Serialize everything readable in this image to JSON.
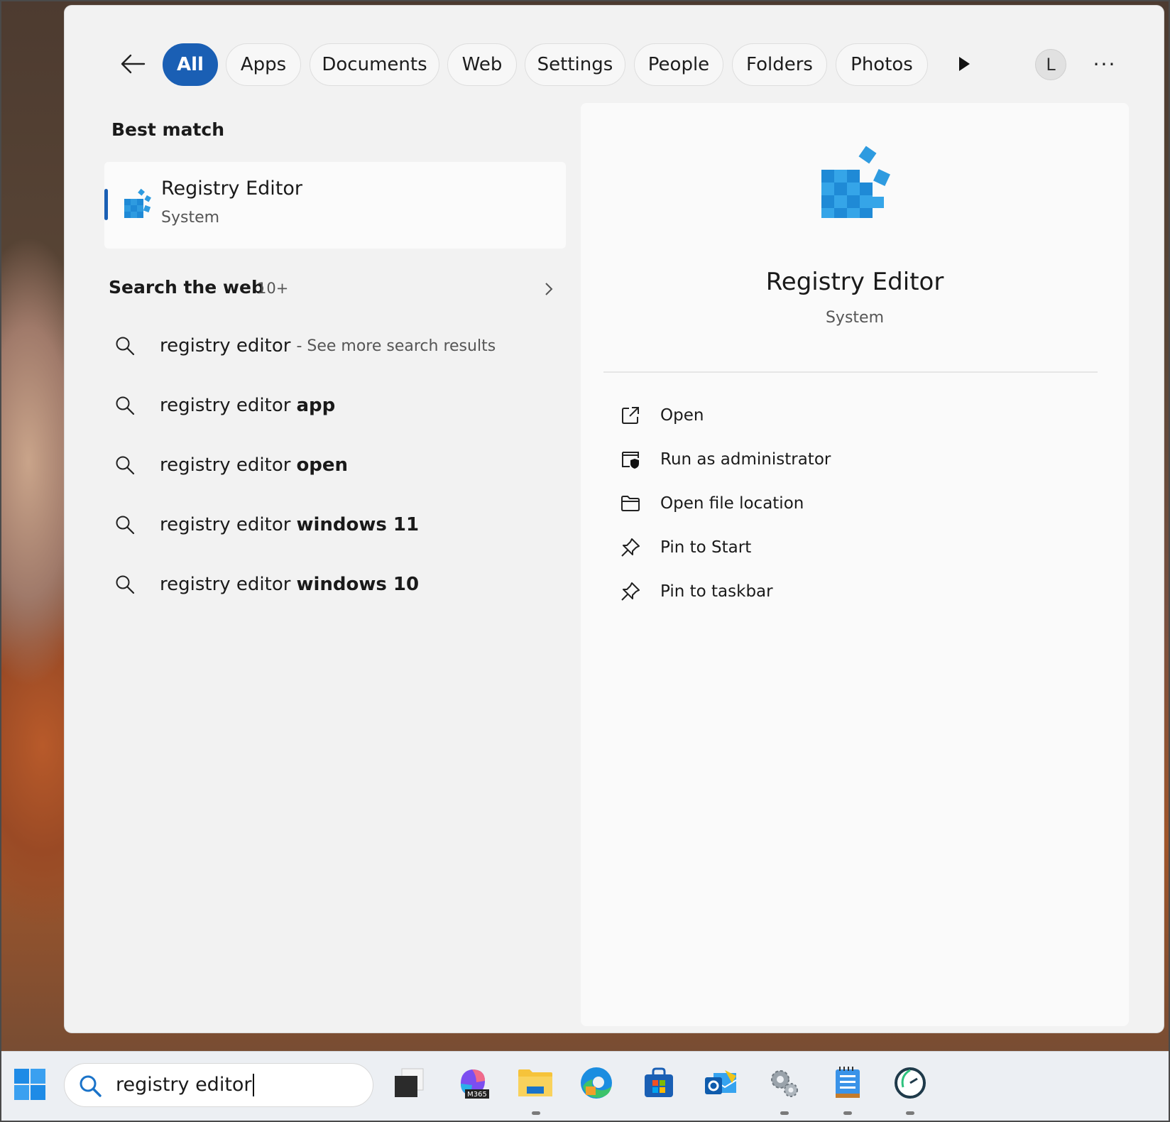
{
  "filters": {
    "tabs": [
      {
        "label": "All",
        "active": true
      },
      {
        "label": "Apps",
        "active": false
      },
      {
        "label": "Documents",
        "active": false
      },
      {
        "label": "Web",
        "active": false
      },
      {
        "label": "Settings",
        "active": false
      },
      {
        "label": "People",
        "active": false
      },
      {
        "label": "Folders",
        "active": false
      },
      {
        "label": "Photos",
        "active": false
      }
    ],
    "avatar_initial": "L",
    "more_label": "···"
  },
  "best_match": {
    "heading": "Best match",
    "title": "Registry Editor",
    "subtitle": "System",
    "icon": "registry-cubes-icon"
  },
  "web": {
    "heading": "Search the web",
    "count": "10+",
    "items": [
      {
        "query": "registry editor",
        "bold": "",
        "suffix": "- See more search results"
      },
      {
        "query": "registry editor",
        "bold": "app",
        "suffix": ""
      },
      {
        "query": "registry editor",
        "bold": "open",
        "suffix": ""
      },
      {
        "query": "registry editor",
        "bold": "windows 11",
        "suffix": ""
      },
      {
        "query": "registry editor",
        "bold": "windows 10",
        "suffix": ""
      }
    ]
  },
  "preview": {
    "title": "Registry Editor",
    "subtitle": "System",
    "actions": [
      {
        "label": "Open",
        "icon": "open-external-icon"
      },
      {
        "label": "Run as administrator",
        "icon": "shield-admin-icon"
      },
      {
        "label": "Open file location",
        "icon": "folder-icon"
      },
      {
        "label": "Pin to Start",
        "icon": "pin-icon"
      },
      {
        "label": "Pin to taskbar",
        "icon": "pin-icon"
      }
    ]
  },
  "taskbar": {
    "search_value": "registry editor",
    "apps": [
      {
        "name": "task-view-icon",
        "running": false
      },
      {
        "name": "microsoft-365-icon",
        "running": false,
        "badge": "M365"
      },
      {
        "name": "file-explorer-icon",
        "running": true
      },
      {
        "name": "edge-icon",
        "running": false
      },
      {
        "name": "store-icon",
        "running": false
      },
      {
        "name": "outlook-icon",
        "running": false
      },
      {
        "name": "settings-gears-icon",
        "running": true
      },
      {
        "name": "notepad-icon",
        "running": true
      },
      {
        "name": "clock-app-icon",
        "running": true
      }
    ]
  },
  "colors": {
    "accent": "#1a5fb4",
    "panel": "#f2f2f2",
    "registry_blue": "#2e9be0"
  }
}
